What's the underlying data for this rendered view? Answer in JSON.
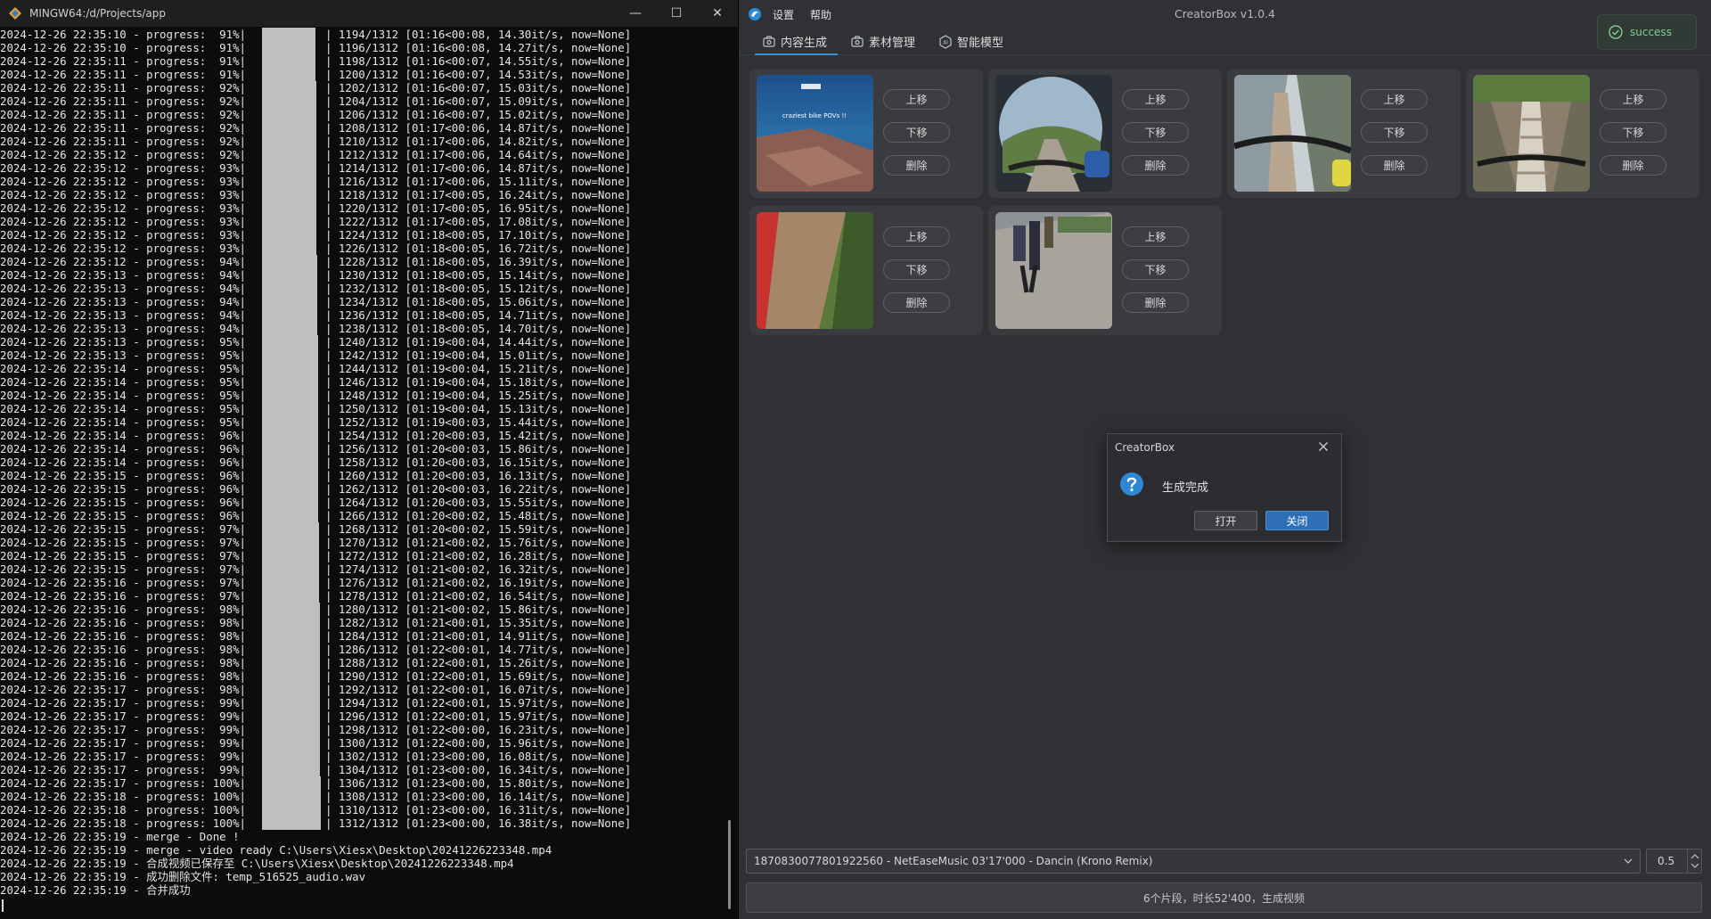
{
  "terminal": {
    "title": "MINGW64:/d/Projects/app",
    "minimize": "—",
    "maximize": "☐",
    "close": "✕",
    "progress_lines": [
      {
        "ts": "2024-12-26 22:35:10",
        "pct": " 91%",
        "count": "1194/1312",
        "info": "[01:16<00:08, 14.30it/s, now=None]",
        "fill": 0.91
      },
      {
        "ts": "2024-12-26 22:35:10",
        "pct": " 91%",
        "count": "1196/1312",
        "info": "[01:16<00:08, 14.27it/s, now=None]",
        "fill": 0.91
      },
      {
        "ts": "2024-12-26 22:35:11",
        "pct": " 91%",
        "count": "1198/1312",
        "info": "[01:16<00:07, 14.55it/s, now=None]",
        "fill": 0.91
      },
      {
        "ts": "2024-12-26 22:35:11",
        "pct": " 91%",
        "count": "1200/1312",
        "info": "[01:16<00:07, 14.53it/s, now=None]",
        "fill": 0.91
      },
      {
        "ts": "2024-12-26 22:35:11",
        "pct": " 92%",
        "count": "1202/1312",
        "info": "[01:16<00:07, 15.03it/s, now=None]",
        "fill": 0.92
      },
      {
        "ts": "2024-12-26 22:35:11",
        "pct": " 92%",
        "count": "1204/1312",
        "info": "[01:16<00:07, 15.09it/s, now=None]",
        "fill": 0.92
      },
      {
        "ts": "2024-12-26 22:35:11",
        "pct": " 92%",
        "count": "1206/1312",
        "info": "[01:16<00:07, 15.02it/s, now=None]",
        "fill": 0.92
      },
      {
        "ts": "2024-12-26 22:35:11",
        "pct": " 92%",
        "count": "1208/1312",
        "info": "[01:17<00:06, 14.87it/s, now=None]",
        "fill": 0.92
      },
      {
        "ts": "2024-12-26 22:35:11",
        "pct": " 92%",
        "count": "1210/1312",
        "info": "[01:17<00:06, 14.82it/s, now=None]",
        "fill": 0.92
      },
      {
        "ts": "2024-12-26 22:35:12",
        "pct": " 92%",
        "count": "1212/1312",
        "info": "[01:17<00:06, 14.64it/s, now=None]",
        "fill": 0.92
      },
      {
        "ts": "2024-12-26 22:35:12",
        "pct": " 93%",
        "count": "1214/1312",
        "info": "[01:17<00:06, 14.87it/s, now=None]",
        "fill": 0.93
      },
      {
        "ts": "2024-12-26 22:35:12",
        "pct": " 93%",
        "count": "1216/1312",
        "info": "[01:17<00:06, 15.11it/s, now=None]",
        "fill": 0.93
      },
      {
        "ts": "2024-12-26 22:35:12",
        "pct": " 93%",
        "count": "1218/1312",
        "info": "[01:17<00:05, 16.24it/s, now=None]",
        "fill": 0.93
      },
      {
        "ts": "2024-12-26 22:35:12",
        "pct": " 93%",
        "count": "1220/1312",
        "info": "[01:17<00:05, 16.95it/s, now=None]",
        "fill": 0.93
      },
      {
        "ts": "2024-12-26 22:35:12",
        "pct": " 93%",
        "count": "1222/1312",
        "info": "[01:17<00:05, 17.08it/s, now=None]",
        "fill": 0.93
      },
      {
        "ts": "2024-12-26 22:35:12",
        "pct": " 93%",
        "count": "1224/1312",
        "info": "[01:18<00:05, 17.10it/s, now=None]",
        "fill": 0.93
      },
      {
        "ts": "2024-12-26 22:35:12",
        "pct": " 93%",
        "count": "1226/1312",
        "info": "[01:18<00:05, 16.72it/s, now=None]",
        "fill": 0.93
      },
      {
        "ts": "2024-12-26 22:35:12",
        "pct": " 94%",
        "count": "1228/1312",
        "info": "[01:18<00:05, 16.39it/s, now=None]",
        "fill": 0.94
      },
      {
        "ts": "2024-12-26 22:35:13",
        "pct": " 94%",
        "count": "1230/1312",
        "info": "[01:18<00:05, 15.14it/s, now=None]",
        "fill": 0.94
      },
      {
        "ts": "2024-12-26 22:35:13",
        "pct": " 94%",
        "count": "1232/1312",
        "info": "[01:18<00:05, 15.12it/s, now=None]",
        "fill": 0.94
      },
      {
        "ts": "2024-12-26 22:35:13",
        "pct": " 94%",
        "count": "1234/1312",
        "info": "[01:18<00:05, 15.06it/s, now=None]",
        "fill": 0.94
      },
      {
        "ts": "2024-12-26 22:35:13",
        "pct": " 94%",
        "count": "1236/1312",
        "info": "[01:18<00:05, 14.71it/s, now=None]",
        "fill": 0.94
      },
      {
        "ts": "2024-12-26 22:35:13",
        "pct": " 94%",
        "count": "1238/1312",
        "info": "[01:18<00:05, 14.70it/s, now=None]",
        "fill": 0.94
      },
      {
        "ts": "2024-12-26 22:35:13",
        "pct": " 95%",
        "count": "1240/1312",
        "info": "[01:19<00:04, 14.44it/s, now=None]",
        "fill": 0.95
      },
      {
        "ts": "2024-12-26 22:35:13",
        "pct": " 95%",
        "count": "1242/1312",
        "info": "[01:19<00:04, 15.01it/s, now=None]",
        "fill": 0.95
      },
      {
        "ts": "2024-12-26 22:35:14",
        "pct": " 95%",
        "count": "1244/1312",
        "info": "[01:19<00:04, 15.21it/s, now=None]",
        "fill": 0.95
      },
      {
        "ts": "2024-12-26 22:35:14",
        "pct": " 95%",
        "count": "1246/1312",
        "info": "[01:19<00:04, 15.18it/s, now=None]",
        "fill": 0.95
      },
      {
        "ts": "2024-12-26 22:35:14",
        "pct": " 95%",
        "count": "1248/1312",
        "info": "[01:19<00:04, 15.25it/s, now=None]",
        "fill": 0.95
      },
      {
        "ts": "2024-12-26 22:35:14",
        "pct": " 95%",
        "count": "1250/1312",
        "info": "[01:19<00:04, 15.13it/s, now=None]",
        "fill": 0.95
      },
      {
        "ts": "2024-12-26 22:35:14",
        "pct": " 95%",
        "count": "1252/1312",
        "info": "[01:19<00:03, 15.44it/s, now=None]",
        "fill": 0.95
      },
      {
        "ts": "2024-12-26 22:35:14",
        "pct": " 96%",
        "count": "1254/1312",
        "info": "[01:20<00:03, 15.42it/s, now=None]",
        "fill": 0.96
      },
      {
        "ts": "2024-12-26 22:35:14",
        "pct": " 96%",
        "count": "1256/1312",
        "info": "[01:20<00:03, 15.86it/s, now=None]",
        "fill": 0.96
      },
      {
        "ts": "2024-12-26 22:35:14",
        "pct": " 96%",
        "count": "1258/1312",
        "info": "[01:20<00:03, 16.15it/s, now=None]",
        "fill": 0.96
      },
      {
        "ts": "2024-12-26 22:35:15",
        "pct": " 96%",
        "count": "1260/1312",
        "info": "[01:20<00:03, 16.13it/s, now=None]",
        "fill": 0.96
      },
      {
        "ts": "2024-12-26 22:35:15",
        "pct": " 96%",
        "count": "1262/1312",
        "info": "[01:20<00:03, 16.22it/s, now=None]",
        "fill": 0.96
      },
      {
        "ts": "2024-12-26 22:35:15",
        "pct": " 96%",
        "count": "1264/1312",
        "info": "[01:20<00:03, 15.55it/s, now=None]",
        "fill": 0.96
      },
      {
        "ts": "2024-12-26 22:35:15",
        "pct": " 96%",
        "count": "1266/1312",
        "info": "[01:20<00:02, 15.48it/s, now=None]",
        "fill": 0.96
      },
      {
        "ts": "2024-12-26 22:35:15",
        "pct": " 97%",
        "count": "1268/1312",
        "info": "[01:20<00:02, 15.59it/s, now=None]",
        "fill": 0.97
      },
      {
        "ts": "2024-12-26 22:35:15",
        "pct": " 97%",
        "count": "1270/1312",
        "info": "[01:21<00:02, 15.76it/s, now=None]",
        "fill": 0.97
      },
      {
        "ts": "2024-12-26 22:35:15",
        "pct": " 97%",
        "count": "1272/1312",
        "info": "[01:21<00:02, 16.28it/s, now=None]",
        "fill": 0.97
      },
      {
        "ts": "2024-12-26 22:35:15",
        "pct": " 97%",
        "count": "1274/1312",
        "info": "[01:21<00:02, 16.32it/s, now=None]",
        "fill": 0.97
      },
      {
        "ts": "2024-12-26 22:35:16",
        "pct": " 97%",
        "count": "1276/1312",
        "info": "[01:21<00:02, 16.19it/s, now=None]",
        "fill": 0.97
      },
      {
        "ts": "2024-12-26 22:35:16",
        "pct": " 97%",
        "count": "1278/1312",
        "info": "[01:21<00:02, 16.54it/s, now=None]",
        "fill": 0.97
      },
      {
        "ts": "2024-12-26 22:35:16",
        "pct": " 98%",
        "count": "1280/1312",
        "info": "[01:21<00:02, 15.86it/s, now=None]",
        "fill": 0.98
      },
      {
        "ts": "2024-12-26 22:35:16",
        "pct": " 98%",
        "count": "1282/1312",
        "info": "[01:21<00:01, 15.35it/s, now=None]",
        "fill": 0.98
      },
      {
        "ts": "2024-12-26 22:35:16",
        "pct": " 98%",
        "count": "1284/1312",
        "info": "[01:21<00:01, 14.91it/s, now=None]",
        "fill": 0.98
      },
      {
        "ts": "2024-12-26 22:35:16",
        "pct": " 98%",
        "count": "1286/1312",
        "info": "[01:22<00:01, 14.77it/s, now=None]",
        "fill": 0.98
      },
      {
        "ts": "2024-12-26 22:35:16",
        "pct": " 98%",
        "count": "1288/1312",
        "info": "[01:22<00:01, 15.26it/s, now=None]",
        "fill": 0.98
      },
      {
        "ts": "2024-12-26 22:35:16",
        "pct": " 98%",
        "count": "1290/1312",
        "info": "[01:22<00:01, 15.69it/s, now=None]",
        "fill": 0.98
      },
      {
        "ts": "2024-12-26 22:35:17",
        "pct": " 98%",
        "count": "1292/1312",
        "info": "[01:22<00:01, 16.07it/s, now=None]",
        "fill": 0.98
      },
      {
        "ts": "2024-12-26 22:35:17",
        "pct": " 99%",
        "count": "1294/1312",
        "info": "[01:22<00:01, 15.97it/s, now=None]",
        "fill": 0.99
      },
      {
        "ts": "2024-12-26 22:35:17",
        "pct": " 99%",
        "count": "1296/1312",
        "info": "[01:22<00:01, 15.97it/s, now=None]",
        "fill": 0.99
      },
      {
        "ts": "2024-12-26 22:35:17",
        "pct": " 99%",
        "count": "1298/1312",
        "info": "[01:22<00:00, 16.23it/s, now=None]",
        "fill": 0.99
      },
      {
        "ts": "2024-12-26 22:35:17",
        "pct": " 99%",
        "count": "1300/1312",
        "info": "[01:22<00:00, 15.96it/s, now=None]",
        "fill": 0.99
      },
      {
        "ts": "2024-12-26 22:35:17",
        "pct": " 99%",
        "count": "1302/1312",
        "info": "[01:23<00:00, 16.08it/s, now=None]",
        "fill": 0.99
      },
      {
        "ts": "2024-12-26 22:35:17",
        "pct": " 99%",
        "count": "1304/1312",
        "info": "[01:23<00:00, 16.34it/s, now=None]",
        "fill": 0.99
      },
      {
        "ts": "2024-12-26 22:35:17",
        "pct": "100%",
        "count": "1306/1312",
        "info": "[01:23<00:00, 15.80it/s, now=None]",
        "fill": 1.0
      },
      {
        "ts": "2024-12-26 22:35:18",
        "pct": "100%",
        "count": "1308/1312",
        "info": "[01:23<00:00, 16.14it/s, now=None]",
        "fill": 1.0
      },
      {
        "ts": "2024-12-26 22:35:18",
        "pct": "100%",
        "count": "1310/1312",
        "info": "[01:23<00:00, 16.31it/s, now=None]",
        "fill": 1.0
      },
      {
        "ts": "2024-12-26 22:35:18",
        "pct": "100%",
        "count": "1312/1312",
        "info": "[01:23<00:00, 16.38it/s, now=None]",
        "fill": 1.0
      }
    ],
    "log_lines": [
      "2024-12-26 22:35:19 - merge - Done !",
      "2024-12-26 22:35:19 - merge - video ready C:\\Users\\Xiesx\\Desktop\\20241226223348.mp4",
      "2024-12-26 22:35:19 - 合成视频已保存至 C:\\Users\\Xiesx\\Desktop\\20241226223348.mp4",
      "2024-12-26 22:35:19 - 成功删除文件: temp_516525_audio.wav",
      "2024-12-26 22:35:19 - 合并成功"
    ]
  },
  "app": {
    "title": "CreatorBox v1.0.4",
    "menu": [
      "设置",
      "帮助"
    ],
    "tabs": [
      {
        "label": "内容生成",
        "icon": "content-icon",
        "active": true
      },
      {
        "label": "素材管理",
        "icon": "material-icon",
        "active": false
      },
      {
        "label": "智能模型",
        "icon": "ai-icon",
        "active": false
      }
    ],
    "clip_buttons": {
      "up": "上移",
      "down": "下移",
      "delete": "删除"
    },
    "clips": [
      {
        "thumb_caption": "craziest bike POVs !!",
        "scene": "lake-cliff"
      },
      {
        "thumb_caption": "",
        "scene": "fisheye-path"
      },
      {
        "thumb_caption": "",
        "scene": "mountain-trail"
      },
      {
        "thumb_caption": "",
        "scene": "rocky-ladder"
      },
      {
        "thumb_caption": "",
        "scene": "red-ramp"
      },
      {
        "thumb_caption": "",
        "scene": "crowd-path"
      }
    ],
    "music_select": "1870830077801922560 - NetEaseMusic 03'17'000 - Dancin (Krono Remix)",
    "volume_value": "0.5",
    "generate_button": "6个片段，时长52'400，生成视频",
    "toast": "success",
    "dialog": {
      "title": "CreatorBox",
      "message": "生成完成",
      "open_button": "打开",
      "close_button": "关闭"
    },
    "colors": {
      "accent": "#3d8fd1",
      "toast_green": "#7fcf93",
      "primary_button": "#2e6fb5"
    }
  }
}
